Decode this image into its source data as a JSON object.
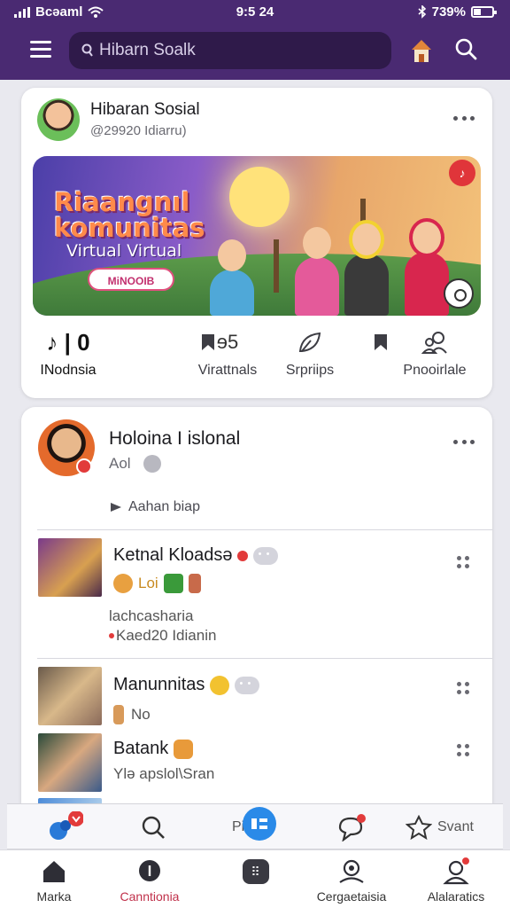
{
  "status_bar": {
    "carrier": "Bcəaml",
    "time": "9:5 24",
    "battery": "739%"
  },
  "appbar": {
    "search_placeholder": "Hibarn Soalk"
  },
  "post_card": {
    "title": "Hibaran Sosial",
    "handle": "@29920 Idiarru)",
    "banner": {
      "title_line1": "Riaangnıl",
      "title_line2": "komunitas",
      "subtitle": "Virtual Virtual",
      "button_label": "MiNOOIB"
    },
    "tabs": [
      {
        "label": "INodnsia",
        "icon": "music-note-icon"
      },
      {
        "label": "Virattnals",
        "icon": "bookmark-icon"
      },
      {
        "label": "Srpriips",
        "icon": "leaf-icon"
      },
      {
        "label": "Pnooirlale",
        "icon": "people-icon"
      }
    ],
    "tab_glyphs": [
      "♪ | 0",
      "ɘ5"
    ]
  },
  "community_card": {
    "name": "Holoina I islonal",
    "meta": "Aol",
    "action": "Aahan biap",
    "rows": [
      {
        "title": "Ketnal Kloadsə",
        "sub1": "Loi",
        "sub2": "lachcasharia",
        "sub3": "Kaed20 Idianin"
      },
      {
        "title": "Manunnitas",
        "sub1": "No"
      },
      {
        "title": "Batank",
        "sub1": "Ylə apslol\\Sran"
      }
    ]
  },
  "quick_actions": {
    "center_label": "Pin",
    "right_label": "Svant"
  },
  "bottom_nav": [
    {
      "label": "Marka",
      "icon": "home-icon"
    },
    {
      "label": "Canntionia",
      "icon": "shield-icon"
    },
    {
      "label": "",
      "icon": "grid-icon"
    },
    {
      "label": "Cergaetaisia",
      "icon": "profile-card-icon"
    },
    {
      "label": "Alalaratics",
      "icon": "notification-user-icon"
    }
  ],
  "colors": {
    "header": "#4a2a72",
    "search_bg": "#2f1a4a",
    "accent_red": "#e23b3b",
    "active_nav": "#c0304a",
    "fab_blue": "#2a8ae8"
  }
}
